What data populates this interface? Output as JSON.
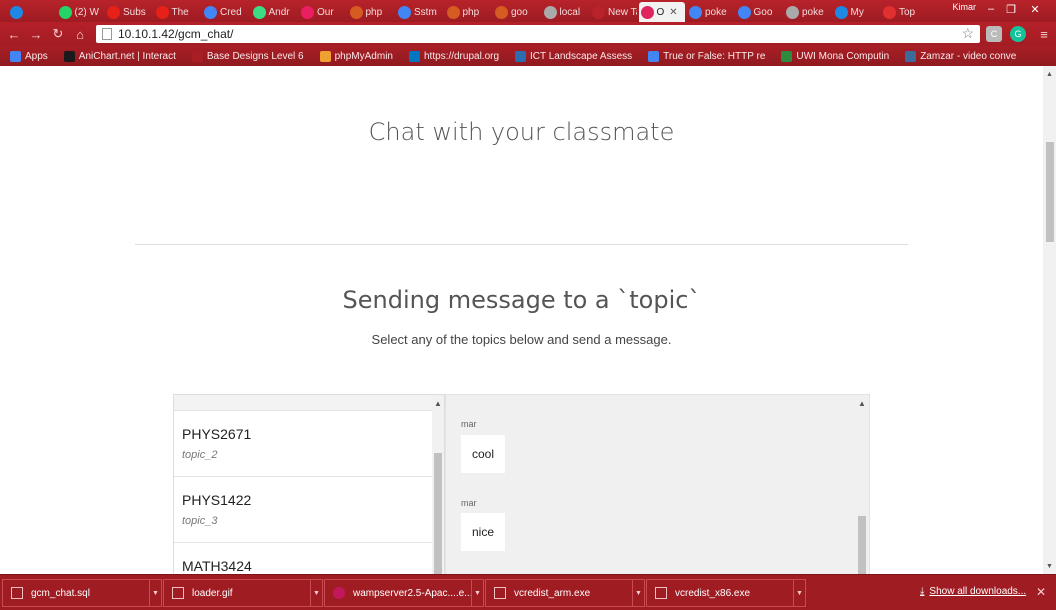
{
  "browser": {
    "tabs": [
      {
        "label": "",
        "color": "#1e88e5"
      },
      {
        "label": "(2) W",
        "color": "#25d366"
      },
      {
        "label": "Subs",
        "color": "#e62117"
      },
      {
        "label": "The",
        "color": "#e62117"
      },
      {
        "label": "Cred",
        "color": "#4285f4"
      },
      {
        "label": "Andr",
        "color": "#3ddc84"
      },
      {
        "label": "Our",
        "color": "#e91e63"
      },
      {
        "label": "php",
        "color": "#d65b20"
      },
      {
        "label": "Sstm",
        "color": "#4285f4"
      },
      {
        "label": "php",
        "color": "#d65b20"
      },
      {
        "label": "goo",
        "color": "#d65b20"
      },
      {
        "label": "local",
        "color": "#aaaaaa"
      },
      {
        "label": "New Tab",
        "color": "#b8232a"
      },
      {
        "label": "O",
        "color": "#e0245e",
        "active": true
      },
      {
        "label": "poke",
        "color": "#4285f4"
      },
      {
        "label": "Goo",
        "color": "#4285f4"
      },
      {
        "label": "poke",
        "color": "#aaaaaa"
      },
      {
        "label": "My",
        "color": "#1e88e5"
      },
      {
        "label": "Top",
        "color": "#e03030"
      }
    ],
    "user": "Kimar",
    "url": "10.10.1.42/gcm_chat/",
    "bookmarks": [
      {
        "label": "Apps",
        "color": "#4285f4"
      },
      {
        "label": "AniChart.net | Interact",
        "color": "#1a1a1a"
      },
      {
        "label": "Base Designs Level 6",
        "color": "#a91e25"
      },
      {
        "label": "phpMyAdmin",
        "color": "#f0a030"
      },
      {
        "label": "https://drupal.org",
        "color": "#0077c0"
      },
      {
        "label": "ICT Landscape Assess",
        "color": "#2a6db0"
      },
      {
        "label": "True or False: HTTP re",
        "color": "#4285f4"
      },
      {
        "label": "UWI Mona Computin",
        "color": "#2e8b3e"
      },
      {
        "label": "Zamzar - video conve",
        "color": "#3d6b9a"
      }
    ]
  },
  "page": {
    "title": "Chat with your classmate",
    "section_title": "Sending message to a `topic`",
    "section_subtitle": "Select any of the topics below and send a message.",
    "topics": [
      {
        "name": "PHYS2671",
        "id": "topic_2"
      },
      {
        "name": "PHYS1422",
        "id": "topic_3"
      },
      {
        "name": "MATH3424",
        "id": ""
      }
    ],
    "messages": [
      {
        "author": "mar",
        "text": "cool"
      },
      {
        "author": "mar",
        "text": "nice"
      }
    ]
  },
  "downloads": {
    "items": [
      "gcm_chat.sql",
      "loader.gif",
      "wampserver2.5-Apac....e...",
      "vcredist_arm.exe",
      "vcredist_x86.exe"
    ],
    "show_all": "Show all downloads..."
  }
}
